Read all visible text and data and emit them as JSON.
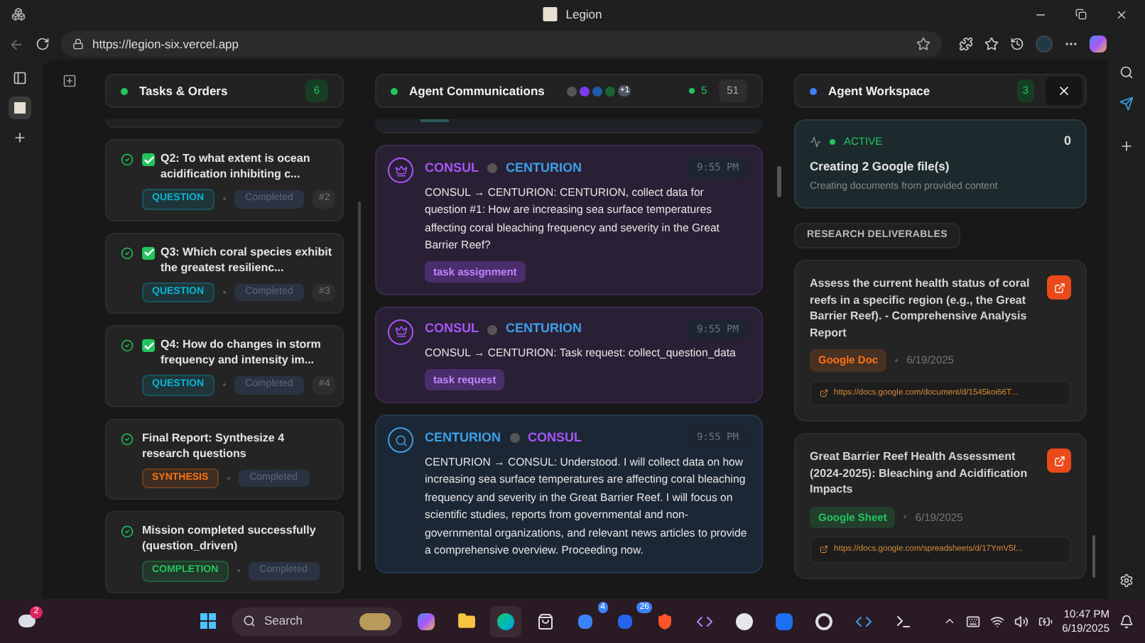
{
  "browser": {
    "tab_title": "Legion",
    "url": "https://legion-six.vercel.app"
  },
  "tasks": {
    "title": "Tasks & Orders",
    "count": "6",
    "items": [
      {
        "checked": true,
        "title": "Q2: To what extent is ocean acidification inhibiting c...",
        "tag": "QUESTION",
        "color": "#06b6d4",
        "status": "Completed",
        "number": "#2"
      },
      {
        "checked": true,
        "title": "Q3: Which coral species exhibit the greatest resilienc...",
        "tag": "QUESTION",
        "color": "#06b6d4",
        "status": "Completed",
        "number": "#3"
      },
      {
        "checked": true,
        "title": "Q4: How do changes in storm frequency and intensity im...",
        "tag": "QUESTION",
        "color": "#06b6d4",
        "status": "Completed",
        "number": "#4"
      },
      {
        "checked": false,
        "title": "Final Report: Synthesize 4 research questions",
        "tag": "SYNTHESIS",
        "color": "#f97316",
        "status": "Completed"
      },
      {
        "checked": false,
        "title": "Mission completed successfully (question_driven)",
        "tag": "COMPLETION",
        "color": "#22c55e",
        "status": "Completed"
      }
    ]
  },
  "comms": {
    "title": "Agent Communications",
    "extra_agents": "+1",
    "online": "5",
    "count": "51",
    "messages": [
      {
        "kind": "consul",
        "from": "CONSUL",
        "to": "CENTURION",
        "time": "9:55 PM",
        "text": "CONSUL → CENTURION: CENTURION, collect data for question #1: How are increasing sea surface temperatures affecting coral bleaching frequency and severity in the Great Barrier Reef?",
        "tag": "task assignment"
      },
      {
        "kind": "consul",
        "from": "CONSUL",
        "to": "CENTURION",
        "time": "9:55 PM",
        "text": "CONSUL → CENTURION: Task request: collect_question_data",
        "tag": "task request"
      },
      {
        "kind": "centurion",
        "from": "CENTURION",
        "to": "CONSUL",
        "time": "9:55 PM",
        "text": "CENTURION → CONSUL: Understood. I will collect data on how increasing sea surface temperatures are affecting coral bleaching frequency and severity in the Great Barrier Reef. I will focus on scientific studies, reports from governmental and non-governmental organizations, and relevant news articles to provide a comprehensive overview. Proceeding now."
      }
    ]
  },
  "workspace": {
    "title": "Agent Workspace",
    "count": "3",
    "activity": {
      "status": "ACTIVE",
      "count": "0",
      "title": "Creating 2 Google file(s)",
      "subtitle": "Creating documents from provided content"
    },
    "section": "RESEARCH DELIVERABLES",
    "deliverables": [
      {
        "kind": "doc",
        "title": "Assess the current health status of coral reefs in a specific region (e.g., the Great Barrier Reef). - Comprehensive Analysis Report",
        "type": "Google Doc",
        "date": "6/19/2025",
        "url": "https://docs.google.com/document/d/1545koi66T..."
      },
      {
        "kind": "sheet",
        "title": "Great Barrier Reef Health Assessment (2024-2025): Bleaching and Acidification Impacts",
        "type": "Google Sheet",
        "date": "6/19/2025",
        "url": "https://docs.google.com/spreadsheets/d/17YmV5f..."
      }
    ]
  },
  "taskbar": {
    "weather_badge": "2",
    "search_placeholder": "Search",
    "badges": [
      "4",
      "26"
    ],
    "time": "10:47 PM",
    "date": "6/19/2025"
  }
}
